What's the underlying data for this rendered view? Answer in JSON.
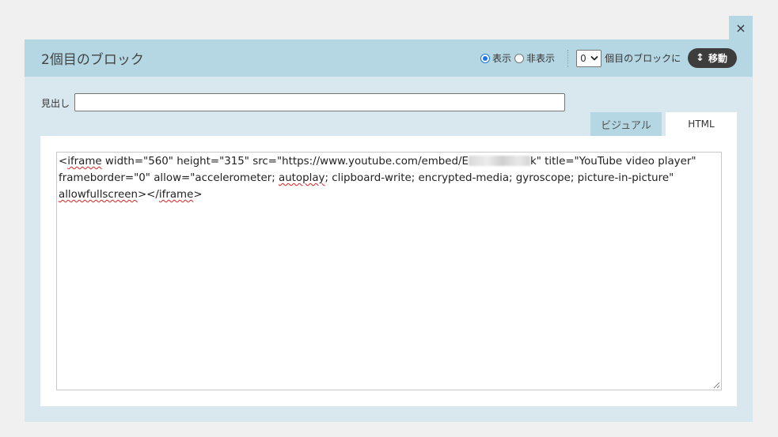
{
  "dialog": {
    "close_label": "×",
    "title": "2個目のブロック"
  },
  "visibility": {
    "show_label": "表示",
    "hide_label": "非表示",
    "selected": "表示"
  },
  "move": {
    "select_value": "0",
    "suffix_label": "個目のブロックに",
    "button_label": "移動",
    "button_icon": "↕"
  },
  "heading": {
    "label": "見出し",
    "value": ""
  },
  "tabs": [
    {
      "label": "ビジュアル",
      "active": false
    },
    {
      "label": "HTML",
      "active": true
    }
  ],
  "editor": {
    "line1": {
      "before": "<",
      "word1": "iframe",
      "mid": " width=\"560\" height=\"315\" src=\"https://www.youtube.com/embed/E",
      "after": "k\" title=\"YouTube video player\""
    },
    "line2": {
      "before": "frameborder=\"0\" allow=\"accelerometer; ",
      "word1": "autoplay",
      "after": "; clipboard-write; encrypted-media; gyroscope; picture-in-picture\""
    },
    "line3": {
      "word1": "allowfullscreen",
      "mid": "></",
      "word2": "iframe",
      "after": ">"
    }
  }
}
